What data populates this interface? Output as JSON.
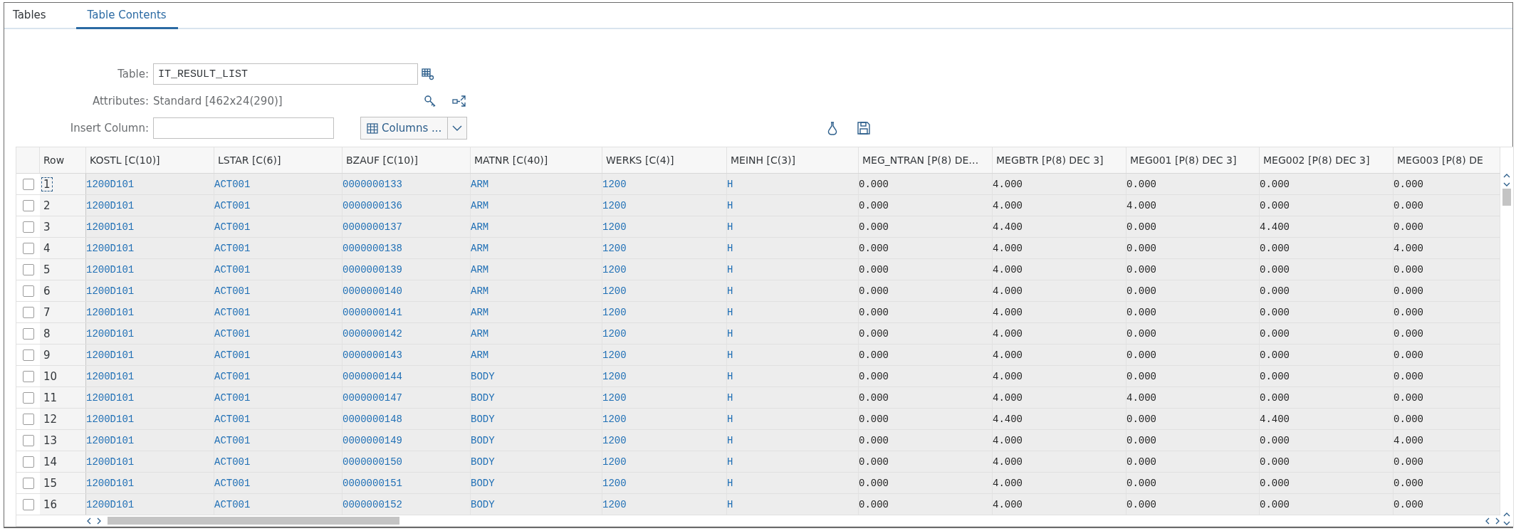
{
  "tabs": [
    {
      "label": "Tables",
      "selected": false
    },
    {
      "label": "Table Contents",
      "selected": true
    }
  ],
  "form": {
    "table_label": "Table:",
    "table_value": "IT_RESULT_LIST",
    "attributes_label": "Attributes:",
    "attributes_value": "Standard [462x24(290)]",
    "insert_column_label": "Insert Column:",
    "columns_button": "Columns ..."
  },
  "table": {
    "row_header": "Row",
    "columns": [
      {
        "label": "KOSTL [C(10)]",
        "kind": "char"
      },
      {
        "label": "LSTAR [C(6)]",
        "kind": "char"
      },
      {
        "label": "BZAUF [C(10)]",
        "kind": "char"
      },
      {
        "label": "MATNR [C(40)]",
        "kind": "char"
      },
      {
        "label": "WERKS [C(4)]",
        "kind": "char"
      },
      {
        "label": "MEINH [C(3)]",
        "kind": "char"
      },
      {
        "label": "MEG_NTRAN [P(8) DE…",
        "kind": "num"
      },
      {
        "label": "MEGBTR [P(8) DEC 3]",
        "kind": "num"
      },
      {
        "label": "MEG001 [P(8) DEC 3]",
        "kind": "num"
      },
      {
        "label": "MEG002 [P(8) DEC 3]",
        "kind": "num"
      },
      {
        "label": "MEG003 [P(8) DE",
        "kind": "num"
      }
    ],
    "rows": [
      {
        "row": "1",
        "selected": false,
        "focused": true,
        "cells": [
          "1200D101",
          "ACT001",
          "0000000133",
          "ARM",
          "1200",
          "H",
          "0.000",
          "4.000",
          "0.000",
          "0.000",
          "0.000"
        ]
      },
      {
        "row": "2",
        "selected": false,
        "focused": false,
        "cells": [
          "1200D101",
          "ACT001",
          "0000000136",
          "ARM",
          "1200",
          "H",
          "0.000",
          "4.000",
          "4.000",
          "0.000",
          "0.000"
        ]
      },
      {
        "row": "3",
        "selected": false,
        "focused": false,
        "cells": [
          "1200D101",
          "ACT001",
          "0000000137",
          "ARM",
          "1200",
          "H",
          "0.000",
          "4.400",
          "0.000",
          "4.400",
          "0.000"
        ]
      },
      {
        "row": "4",
        "selected": false,
        "focused": false,
        "cells": [
          "1200D101",
          "ACT001",
          "0000000138",
          "ARM",
          "1200",
          "H",
          "0.000",
          "4.000",
          "0.000",
          "0.000",
          "4.000"
        ]
      },
      {
        "row": "5",
        "selected": false,
        "focused": false,
        "cells": [
          "1200D101",
          "ACT001",
          "0000000139",
          "ARM",
          "1200",
          "H",
          "0.000",
          "4.000",
          "0.000",
          "0.000",
          "0.000"
        ]
      },
      {
        "row": "6",
        "selected": false,
        "focused": false,
        "cells": [
          "1200D101",
          "ACT001",
          "0000000140",
          "ARM",
          "1200",
          "H",
          "0.000",
          "4.000",
          "0.000",
          "0.000",
          "0.000"
        ]
      },
      {
        "row": "7",
        "selected": false,
        "focused": false,
        "cells": [
          "1200D101",
          "ACT001",
          "0000000141",
          "ARM",
          "1200",
          "H",
          "0.000",
          "4.000",
          "0.000",
          "0.000",
          "0.000"
        ]
      },
      {
        "row": "8",
        "selected": false,
        "focused": false,
        "cells": [
          "1200D101",
          "ACT001",
          "0000000142",
          "ARM",
          "1200",
          "H",
          "0.000",
          "4.000",
          "0.000",
          "0.000",
          "0.000"
        ]
      },
      {
        "row": "9",
        "selected": false,
        "focused": false,
        "cells": [
          "1200D101",
          "ACT001",
          "0000000143",
          "ARM",
          "1200",
          "H",
          "0.000",
          "4.000",
          "0.000",
          "0.000",
          "0.000"
        ]
      },
      {
        "row": "10",
        "selected": false,
        "focused": false,
        "cells": [
          "1200D101",
          "ACT001",
          "0000000144",
          "BODY",
          "1200",
          "H",
          "0.000",
          "4.000",
          "0.000",
          "0.000",
          "0.000"
        ]
      },
      {
        "row": "11",
        "selected": false,
        "focused": false,
        "cells": [
          "1200D101",
          "ACT001",
          "0000000147",
          "BODY",
          "1200",
          "H",
          "0.000",
          "4.000",
          "4.000",
          "0.000",
          "0.000"
        ]
      },
      {
        "row": "12",
        "selected": false,
        "focused": false,
        "cells": [
          "1200D101",
          "ACT001",
          "0000000148",
          "BODY",
          "1200",
          "H",
          "0.000",
          "4.400",
          "0.000",
          "4.400",
          "0.000"
        ]
      },
      {
        "row": "13",
        "selected": false,
        "focused": false,
        "cells": [
          "1200D101",
          "ACT001",
          "0000000149",
          "BODY",
          "1200",
          "H",
          "0.000",
          "4.000",
          "0.000",
          "0.000",
          "4.000"
        ]
      },
      {
        "row": "14",
        "selected": false,
        "focused": false,
        "cells": [
          "1200D101",
          "ACT001",
          "0000000150",
          "BODY",
          "1200",
          "H",
          "0.000",
          "4.000",
          "0.000",
          "0.000",
          "0.000"
        ]
      },
      {
        "row": "15",
        "selected": false,
        "focused": false,
        "cells": [
          "1200D101",
          "ACT001",
          "0000000151",
          "BODY",
          "1200",
          "H",
          "0.000",
          "4.000",
          "0.000",
          "0.000",
          "0.000"
        ]
      },
      {
        "row": "16",
        "selected": false,
        "focused": false,
        "cells": [
          "1200D101",
          "ACT001",
          "0000000152",
          "BODY",
          "1200",
          "H",
          "0.000",
          "4.000",
          "0.000",
          "0.000",
          "0.000"
        ]
      }
    ]
  }
}
